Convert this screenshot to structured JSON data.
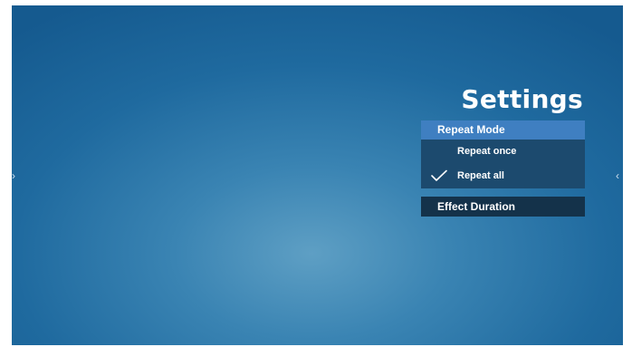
{
  "page": {
    "title": "Settings"
  },
  "menu": {
    "header": "Repeat Mode",
    "options": [
      {
        "label": "Repeat once",
        "selected": false
      },
      {
        "label": "Repeat all",
        "selected": true
      }
    ],
    "next_item": "Effect Duration"
  },
  "nav": {
    "left_arrow": "›",
    "right_arrow": "‹"
  },
  "colors": {
    "header_bg": "#3f7fc1",
    "submenu_bg": "#1c4a6e",
    "item_bg": "#14324a"
  },
  "icons": {
    "selected_option": "checkmark-icon"
  }
}
